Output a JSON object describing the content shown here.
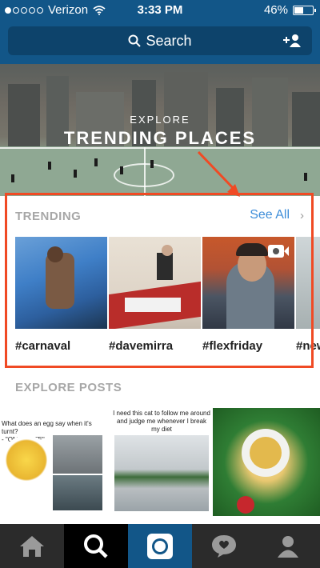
{
  "status_bar": {
    "carrier": "Verizon",
    "time": "3:33 PM",
    "battery": "46%"
  },
  "search": {
    "label": "Search"
  },
  "hero": {
    "eyebrow": "EXPLORE",
    "title": "TRENDING PLACES"
  },
  "trending": {
    "title": "TRENDING",
    "see_all": "See All",
    "items": [
      {
        "tag": "#carnaval"
      },
      {
        "tag": "#davemirra"
      },
      {
        "tag": "#flexfriday"
      },
      {
        "tag": "#new"
      }
    ]
  },
  "explore_posts": {
    "title": "EXPLORE POSTS",
    "posts": [
      {
        "caption_top": "What does an egg say when it's turnt?",
        "caption_bottom": "- \"OMELETTE\""
      },
      {
        "caption_top": "I need this cat to follow me around and judge me whenever I break my diet"
      },
      {}
    ]
  },
  "colors": {
    "header": "#125688",
    "highlight": "#f04a24",
    "link": "#3f8ed9"
  },
  "tabbar": {
    "tabs": [
      {
        "icon": "home-icon"
      },
      {
        "icon": "search-icon"
      },
      {
        "icon": "camera-icon"
      },
      {
        "icon": "activity-icon"
      },
      {
        "icon": "profile-icon"
      }
    ]
  }
}
